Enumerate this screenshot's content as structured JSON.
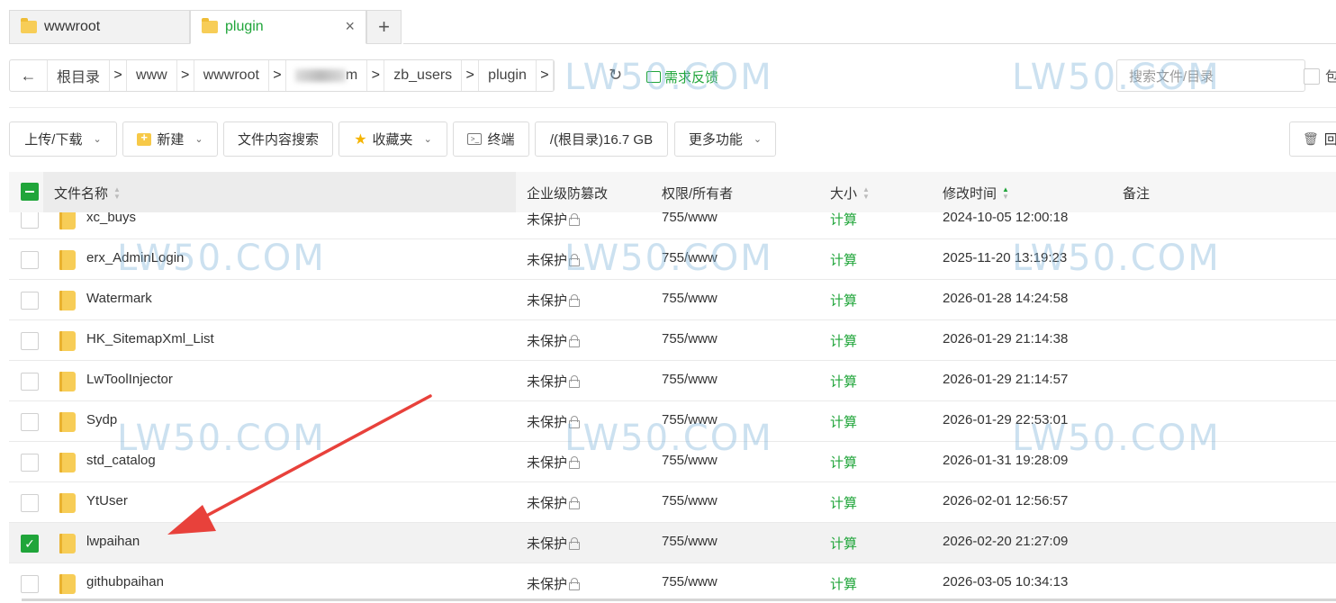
{
  "tabs": [
    {
      "label": "wwwroot",
      "active": false
    },
    {
      "label": "plugin",
      "active": true
    }
  ],
  "tab_close_symbol": "×",
  "tab_add_symbol": "+",
  "breadcrumb": {
    "back_symbol": "←",
    "items": [
      "根目录",
      "www",
      "wwwroot",
      "m",
      "zb_users",
      "plugin"
    ],
    "separator": ">"
  },
  "refresh_symbol": "↻",
  "feedback_label": "需求反馈",
  "search": {
    "placeholder": "搜索文件/目录",
    "include_sub_label": "包"
  },
  "toolbar": {
    "upload_label": "上传/下载",
    "new_label": "新建",
    "content_search_label": "文件内容搜索",
    "favorites_label": "收藏夹",
    "terminal_label": "终端",
    "disk_label": "/(根目录)16.7 GB",
    "more_label": "更多功能",
    "recycle_label": "回"
  },
  "table": {
    "columns": [
      "文件名称",
      "企业级防篡改",
      "权限/所有者",
      "大小",
      "修改时间",
      "备注"
    ],
    "rows": [
      {
        "name": "xc_buys",
        "protect": "未保护",
        "perm": "755/www",
        "size": "计算",
        "time": "2024-10-05 12:00:18",
        "selected": false
      },
      {
        "name": "erx_AdminLogin",
        "protect": "未保护",
        "perm": "755/www",
        "size": "计算",
        "time": "2025-11-20 13:19:23",
        "selected": false
      },
      {
        "name": "Watermark",
        "protect": "未保护",
        "perm": "755/www",
        "size": "计算",
        "time": "2026-01-28 14:24:58",
        "selected": false
      },
      {
        "name": "HK_SitemapXml_List",
        "protect": "未保护",
        "perm": "755/www",
        "size": "计算",
        "time": "2026-01-29 21:14:38",
        "selected": false
      },
      {
        "name": "LwToolInjector",
        "protect": "未保护",
        "perm": "755/www",
        "size": "计算",
        "time": "2026-01-29 21:14:57",
        "selected": false
      },
      {
        "name": "Sydp",
        "protect": "未保护",
        "perm": "755/www",
        "size": "计算",
        "time": "2026-01-29 22:53:01",
        "selected": false
      },
      {
        "name": "std_catalog",
        "protect": "未保护",
        "perm": "755/www",
        "size": "计算",
        "time": "2026-01-31 19:28:09",
        "selected": false
      },
      {
        "name": "YtUser",
        "protect": "未保护",
        "perm": "755/www",
        "size": "计算",
        "time": "2026-02-01 12:56:57",
        "selected": false
      },
      {
        "name": "lwpaihan",
        "protect": "未保护",
        "perm": "755/www",
        "size": "计算",
        "time": "2026-02-20 21:27:09",
        "selected": true
      },
      {
        "name": "githubpaihan",
        "protect": "未保护",
        "perm": "755/www",
        "size": "计算",
        "time": "2026-03-05 10:34:13",
        "selected": false
      }
    ]
  },
  "watermark_text": "LW50.COM",
  "colors": {
    "accent": "#20a53a",
    "arrow": "#e8413b",
    "watermark": "#78afd7"
  }
}
